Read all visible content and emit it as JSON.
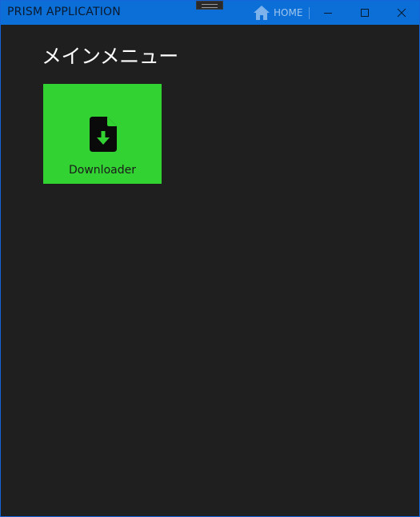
{
  "window": {
    "title": "PRISM APPLICATION",
    "home_label": "HOME",
    "home_icon": "home-icon",
    "minimize_icon": "minimize-icon",
    "maximize_icon": "maximize-icon",
    "close_icon": "close-icon"
  },
  "main": {
    "title": "メインメニュー",
    "tiles": [
      {
        "label": "Downloader",
        "icon": "file-download-icon",
        "color": "#32d232"
      }
    ]
  },
  "colors": {
    "titlebar": "#0c6fd8",
    "background": "#1f1f1f",
    "tile": "#32d232",
    "home_accent": "#7db3ea"
  }
}
